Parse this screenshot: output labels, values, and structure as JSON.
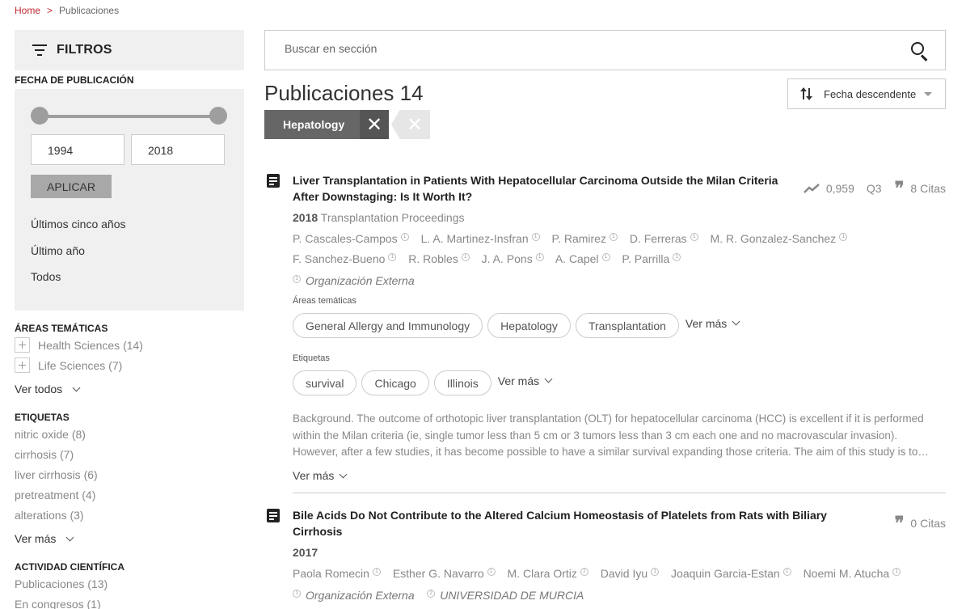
{
  "breadcrumb": {
    "home": "Home",
    "sep": ">",
    "current": "Publicaciones"
  },
  "filters": {
    "title": "FILTROS",
    "date_section": "FECHA DE PUBLICACIÓN",
    "date_range": {
      "min": 1994,
      "max": 2018
    },
    "year_from": "1994",
    "year_to": "2018",
    "apply": "APLICAR",
    "date_options": [
      "Últimos cinco años",
      "Último año",
      "Todos"
    ],
    "areas_title": "ÁREAS TEMÁTICAS",
    "areas": [
      {
        "label": "Health Sciences",
        "count": "(14)"
      },
      {
        "label": "Life Sciences",
        "count": "(7)"
      }
    ],
    "areas_more": "Ver todos",
    "tags_title": "ETIQUETAS",
    "tags": [
      {
        "label": "nitric oxide",
        "count": "(8)"
      },
      {
        "label": "cirrhosis",
        "count": "(7)"
      },
      {
        "label": "liver cirrhosis",
        "count": "(6)"
      },
      {
        "label": "pretreatment",
        "count": "(4)"
      },
      {
        "label": "alterations",
        "count": "(3)"
      }
    ],
    "tags_more": "Ver más",
    "activity_title": "ACTIVIDAD CIENTÍFICA",
    "activity": [
      {
        "label": "Publicaciones",
        "count": "(13)"
      },
      {
        "label": "En congresos",
        "count": "(1)"
      }
    ]
  },
  "search": {
    "placeholder": "Buscar en sección"
  },
  "main": {
    "title": "Publicaciones",
    "count": "14",
    "sort_label": "Fecha descendente",
    "active_filter": "Hepatology",
    "close_glyph": "✕"
  },
  "publications": [
    {
      "title": "Liver Transplantation in Patients With Hepatocellular Carcinoma Outside the Milan Criteria After Downstaging: Is It Worth It?",
      "impact": "0,959",
      "quartile": "Q3",
      "citations": "8 Citas",
      "year": "2018",
      "journal": "Transplantation Proceedings",
      "authors_line1": [
        {
          "name": "P. Cascales-Campos",
          "aff": "1"
        },
        {
          "name": "L. A. Martinez-Insfran",
          "aff": "1"
        },
        {
          "name": "P. Ramirez",
          "aff": "1"
        },
        {
          "name": "D. Ferreras",
          "aff": "1"
        },
        {
          "name": "M. R. Gonzalez-Sanchez",
          "aff": "1"
        }
      ],
      "authors_line2": [
        {
          "name": "F. Sanchez-Bueno",
          "aff": "1"
        },
        {
          "name": "R. Robles",
          "aff": "1"
        },
        {
          "name": "J. A. Pons",
          "aff": "1"
        },
        {
          "name": "A. Capel",
          "aff": "1"
        },
        {
          "name": "P. Parrilla",
          "aff": "1"
        }
      ],
      "org": {
        "aff": "1",
        "name": "Organización Externa"
      },
      "areas_label": "Áreas temáticas",
      "areas": [
        "General Allergy and Immunology",
        "Hepatology",
        "Transplantation"
      ],
      "tags_label": "Etiquetas",
      "tags": [
        "survival",
        "Chicago",
        "Illinois"
      ],
      "more": "Ver más",
      "abstract": "Background. The outcome of orthotopic liver transplantation (OLT) for hepatocellular carcinoma (HCC) is excellent if it is performed within the Milan criteria (ie, single tumor less than 5 cm or 3 tumors less than 3 cm each one and no macrovascular invasion). However, after a few studies, it has become possible to have a similar survival expanding those criteria. The aim of this study is to…",
      "abstract_more": "Ver más"
    },
    {
      "title": "Bile Acids Do Not Contribute to the Altered Calcium Homeostasis of Platelets from Rats with Biliary Cirrhosis",
      "citations": "0 Citas",
      "year": "2017",
      "authors": [
        {
          "name": "Paola Romecin",
          "aff": "1"
        },
        {
          "name": "Esther G. Navarro",
          "aff": "1"
        },
        {
          "name": "M. Clara Ortiz",
          "aff": "2"
        },
        {
          "name": "David Iyu",
          "aff": "1"
        },
        {
          "name": "Joaquin Garcia-Estan",
          "aff": "1"
        },
        {
          "name": "Noemi M. Atucha",
          "aff": "1"
        }
      ],
      "orgs": [
        {
          "aff": "1",
          "name": "Organización Externa"
        },
        {
          "aff": "2",
          "name": "UNIVERSIDAD DE MURCIA"
        }
      ]
    }
  ],
  "icons": {
    "filter": "filter-lines-icon",
    "search": "search-icon",
    "sort": "sort-arrows-icon",
    "doc": "article-icon",
    "trend": "trend-icon",
    "quote": "quote-icon"
  }
}
